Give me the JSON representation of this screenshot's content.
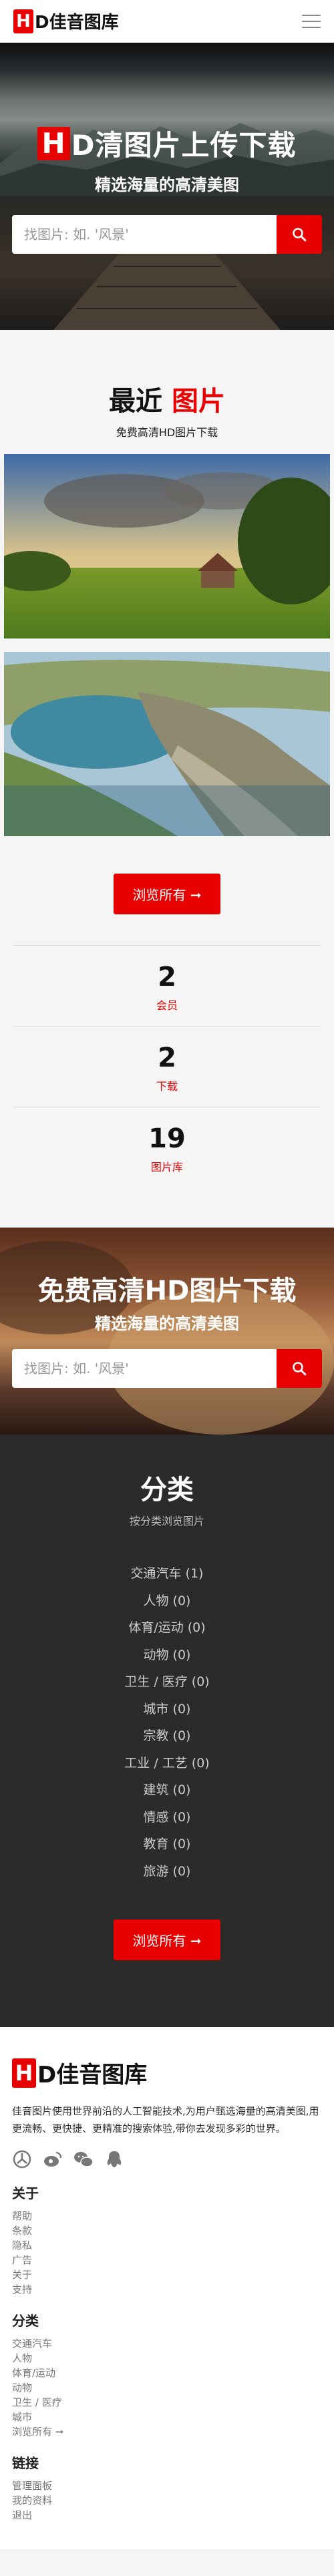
{
  "header": {
    "logo_letter": "H",
    "logo_text": "D佳音图库"
  },
  "hero": {
    "title_highlight": "H",
    "title_rest": "D清图片上传下载",
    "subtitle": "精选海量的高清美图",
    "search_placeholder": "找图片: 如. '风景'"
  },
  "recent": {
    "title_black": "最近",
    "title_red": "图片",
    "subtitle": "免费高清HD图片下载",
    "browse_button": "浏览所有 ➞",
    "stats": [
      {
        "num": "2",
        "label": "会员"
      },
      {
        "num": "2",
        "label": "下载"
      },
      {
        "num": "19",
        "label": "图片库"
      }
    ]
  },
  "banner2": {
    "title": "免费高清HD图片下载",
    "subtitle": "精选海量的高清美图",
    "search_placeholder": "找图片: 如. '风景'"
  },
  "categories": {
    "title": "分类",
    "subtitle": "按分类浏览图片",
    "items": [
      "交通汽车 (1)",
      "人物 (0)",
      "体育/运动 (0)",
      "动物 (0)",
      "卫生 / 医疗 (0)",
      "城市 (0)",
      "宗教 (0)",
      "工业 / 工艺 (0)",
      "建筑 (0)",
      "情感 (0)",
      "教育 (0)",
      "旅游 (0)"
    ],
    "browse_button": "浏览所有 ➞"
  },
  "footer": {
    "logo_letter": "H",
    "logo_text": "D佳音图库",
    "description": "佳音图片使用世界前沿的人工智能技术,为用户甄选海量的高清美图,用更流畅、更快捷、更精准的搜索体验,带你去发现多彩的世界。",
    "about_title": "关于",
    "about_links": [
      "帮助",
      "条款",
      "隐私",
      "广告",
      "关于",
      "支持"
    ],
    "category_title": "分类",
    "category_links": [
      "交通汽车",
      "人物",
      "体育/运动",
      "动物",
      "卫生 / 医疗",
      "城市",
      "浏览所有 ➞"
    ],
    "link_title": "链接",
    "link_links": [
      "管理面板",
      "我的资料",
      "退出"
    ]
  },
  "icons": [
    "menu-icon",
    "search-icon",
    "qq-icon",
    "weibo-icon",
    "wechat-icon",
    "qq-penguin-icon"
  ],
  "colors": {
    "accent": "#e60000",
    "dark_section": "#2b2b2b"
  }
}
